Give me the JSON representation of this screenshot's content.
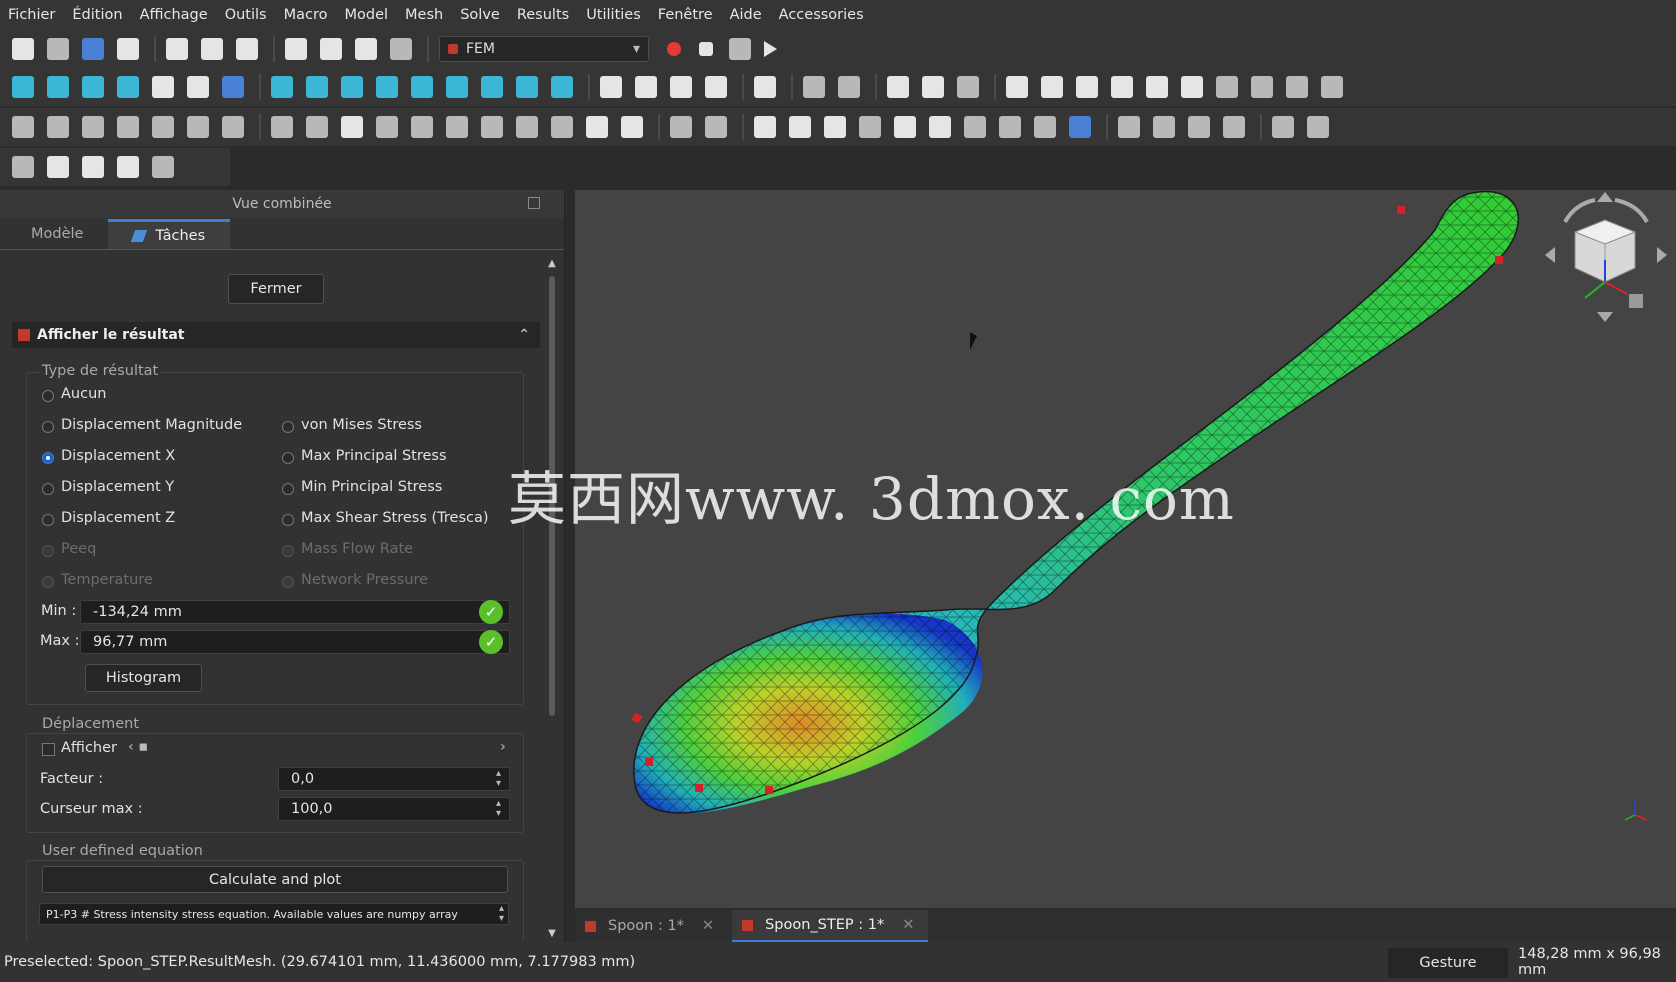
{
  "menu": [
    "Fichier",
    "Édition",
    "Affichage",
    "Outils",
    "Macro",
    "Model",
    "Mesh",
    "Solve",
    "Results",
    "Utilities",
    "Fenêtre",
    "Aide",
    "Accessories"
  ],
  "toolbar": {
    "workbench": "FEM"
  },
  "panel": {
    "title": "Vue combinée",
    "tabs": [
      "Modèle",
      "Tâches"
    ],
    "close_button": "Fermer",
    "section_title": "Afficher le résultat",
    "result_type_label": "Type de résultat",
    "options_left": [
      "Aucun",
      "Displacement Magnitude",
      "Displacement X",
      "Displacement Y",
      "Displacement Z",
      "Peeq",
      "Temperature"
    ],
    "options_right": [
      "von Mises Stress",
      "Max Principal Stress",
      "Min Principal Stress",
      "Max Shear Stress (Tresca)",
      "Mass Flow Rate",
      "Network Pressure"
    ],
    "selected": "Displacement X",
    "min_label": "Min :",
    "min_value": "-134,24 mm",
    "max_label": "Max :",
    "max_value": "96,77 mm",
    "histogram_button": "Histogram",
    "displacement_label": "Déplacement",
    "show_label": "Afficher",
    "factor_label": "Facteur :",
    "factor_value": "0,0",
    "slider_max_label": "Curseur max :",
    "slider_max_value": "100,0",
    "equation_label": "User defined equation",
    "calculate_button": "Calculate and plot",
    "equation_value": "P1-P3 # Stress intensity stress equation. Available values are numpy array"
  },
  "doc_tabs": [
    "Spoon : 1*",
    "Spoon_STEP : 1*"
  ],
  "watermark": "莫西网www. 3dmox. com",
  "status": {
    "preselected": "Preselected: Spoon_STEP.ResultMesh. (29.674101 mm, 11.436000 mm, 7.177983 mm)",
    "navigation": "Gesture",
    "dimensions": "148,28 mm x 96,98 mm"
  },
  "colors": {
    "accent": "#3f7fd3",
    "ok": "#5bbf2c",
    "viewport": "#444444"
  }
}
